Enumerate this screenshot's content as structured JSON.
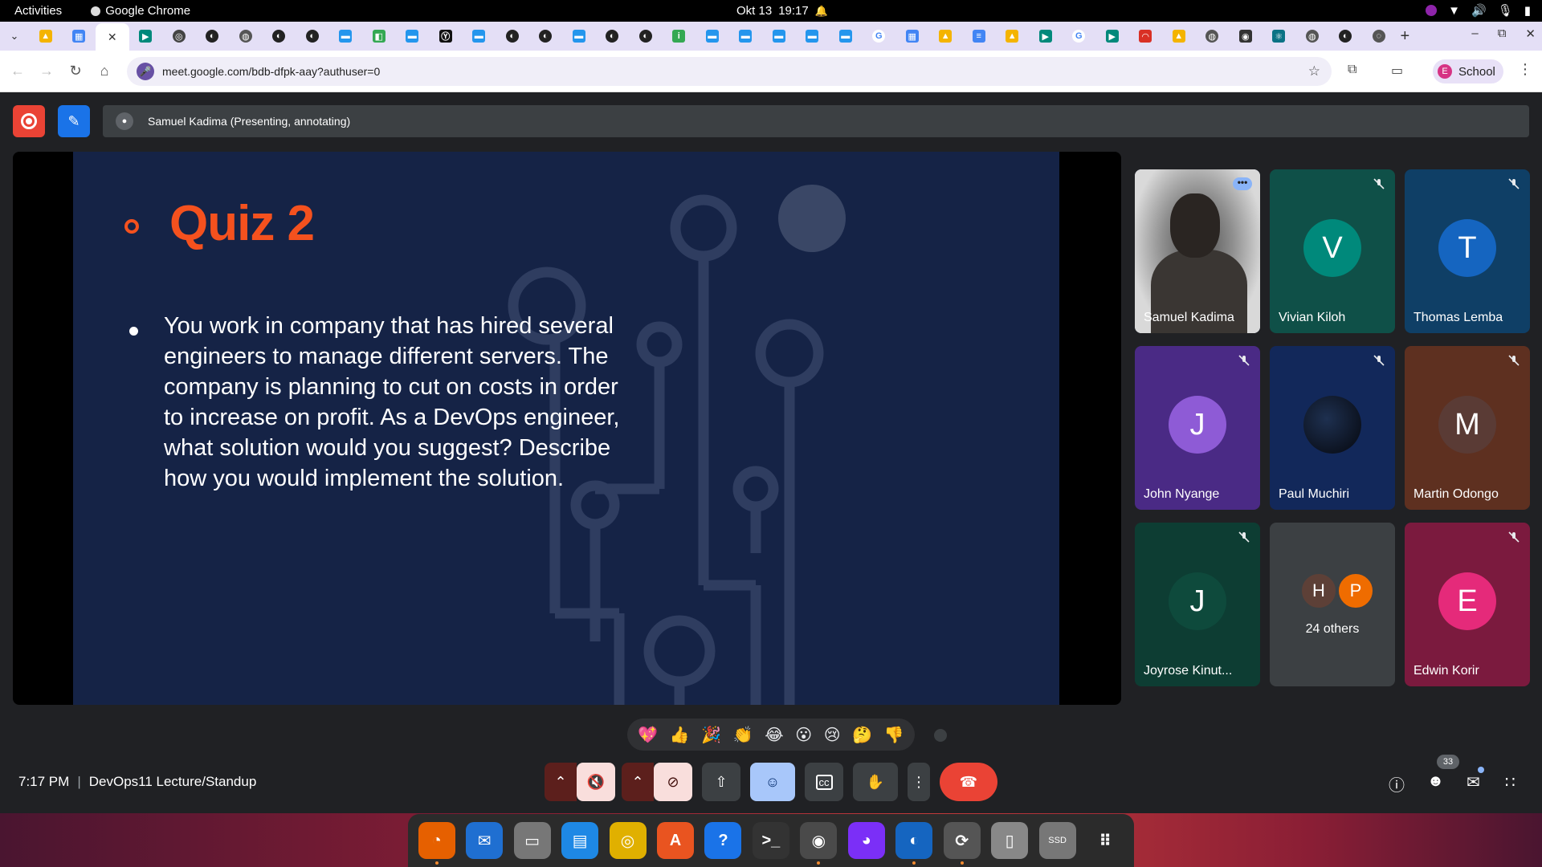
{
  "system_bar": {
    "activities": "Activities",
    "app_name": "Google Chrome",
    "date": "Okt 13",
    "time": "19:17"
  },
  "browser": {
    "url": "meet.google.com/bdb-dfpk-aay?authuser=0",
    "profile_initial": "E",
    "profile_label": "School",
    "tab_favicons": [
      "drive",
      "calendar",
      "meet-active-close",
      "meet",
      "openai",
      "github",
      "globe",
      "github",
      "github",
      "docker",
      "drive-split",
      "docker",
      "yt-l",
      "docker",
      "github",
      "github",
      "docker",
      "github",
      "github",
      "green-i",
      "docker",
      "docker",
      "docker",
      "docker",
      "docker",
      "google",
      "calendar",
      "drive",
      "docs",
      "drive",
      "meet",
      "google",
      "meet",
      "gauge",
      "drive",
      "globe",
      "circle-app",
      "react",
      "globe",
      "github",
      "chrome-globe"
    ],
    "new_tab": "+"
  },
  "meet": {
    "presenter_label": "Samuel Kadima (Presenting, annotating)",
    "slide": {
      "title": "Quiz 2",
      "question": "You work in company that has hired several engineers to manage different servers. The company is planning to cut on costs in order to increase on profit. As a DevOps engineer, what solution would you suggest? Describe how you would implement the solution."
    },
    "participants": [
      {
        "name": "Samuel Kadima",
        "initial": "",
        "color": "#9e9e9e",
        "tile": "#3c4043",
        "muted": false,
        "has_video": true
      },
      {
        "name": "Vivian Kiloh",
        "initial": "V",
        "color": "#00897b",
        "tile": "#0f5048",
        "muted": true
      },
      {
        "name": "Thomas Lemba",
        "initial": "T",
        "color": "#1565c0",
        "tile": "#0f3f66",
        "muted": true
      },
      {
        "name": "John Nyange",
        "initial": "J",
        "color": "#8e5bd6",
        "tile": "#4a2a85",
        "muted": true
      },
      {
        "name": "Paul Muchiri",
        "initial": "",
        "color": "#0b1020",
        "tile": "#12285a",
        "muted": true
      },
      {
        "name": "Martin Odongo",
        "initial": "M",
        "color": "#5a3b35",
        "tile": "#5e3020",
        "muted": true
      },
      {
        "name": "Joyrose Kinut...",
        "initial": "J",
        "color": "#0e4a3c",
        "tile": "#0d3d33",
        "muted": true
      },
      {
        "name": "Edwin Korir",
        "initial": "E",
        "color": "#e52a7a",
        "tile": "#7b1a3e",
        "muted": true
      }
    ],
    "others": {
      "label": "24 others",
      "initials": [
        "H",
        "P"
      ],
      "colors": [
        "#5d4037",
        "#ef6c00"
      ]
    },
    "reactions": [
      "💖",
      "👍",
      "🎉",
      "👏",
      "😂",
      "😮",
      "😢",
      "🤔",
      "👎"
    ],
    "meeting_time": "7:17 PM",
    "separator": "|",
    "meeting_title": "DevOps11 Lecture/Standup",
    "participant_count": "33"
  },
  "dock": {
    "apps": [
      "firefox",
      "thunderbird",
      "files",
      "writer",
      "rhythmbox",
      "app-center",
      "help",
      "terminal",
      "chrome",
      "firefox-dev",
      "cursor",
      "software-updater",
      "disk",
      "ssd",
      "show-apps"
    ],
    "ssd_label": "SSD"
  },
  "colors": {
    "accent_orange": "#f4511e",
    "slide_bg": "#152346",
    "hangup_red": "#ea4335",
    "meet_bg": "#202124"
  }
}
